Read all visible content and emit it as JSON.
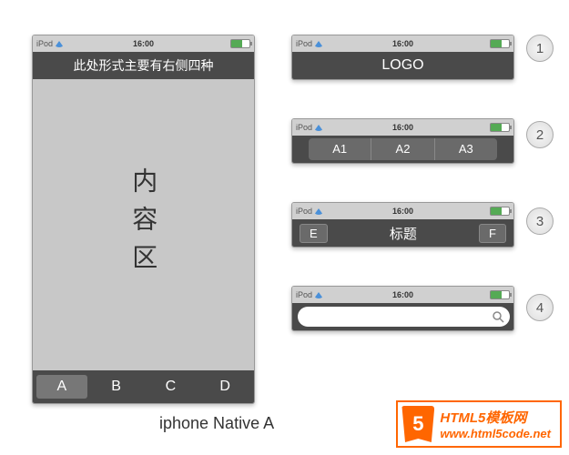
{
  "status": {
    "carrier": "iPod",
    "time": "16:00"
  },
  "main": {
    "header_text": "此处形式主要有右侧四种",
    "content_label": "内容区",
    "tabs": [
      "A",
      "B",
      "C",
      "D"
    ]
  },
  "variants": {
    "v1": {
      "label": "LOGO"
    },
    "v2": {
      "segments": [
        "A1",
        "A2",
        "A3"
      ]
    },
    "v3": {
      "left_btn": "E",
      "title": "标题",
      "right_btn": "F"
    },
    "v4": {
      "search_placeholder": ""
    }
  },
  "badges": [
    "1",
    "2",
    "3",
    "4"
  ],
  "caption": "iphone Native A",
  "watermark": {
    "icon": "5",
    "line1": "HTML5模板网",
    "line2": "www.html5code.net"
  }
}
